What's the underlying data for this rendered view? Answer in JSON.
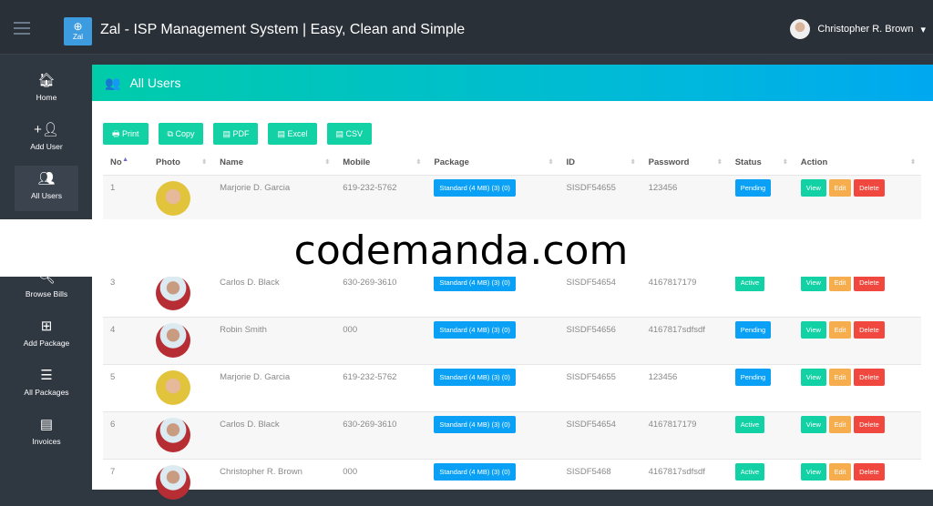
{
  "header": {
    "title": "Zal - ISP Management System | Easy, Clean and Simple",
    "logo_text": "Zal",
    "user": "Christopher R. Brown"
  },
  "sidebar": {
    "items": [
      {
        "label": "Home",
        "icon": "home-icon"
      },
      {
        "label": "Add User",
        "icon": "user-plus-icon"
      },
      {
        "label": "All Users",
        "icon": "users-icon"
      },
      {
        "label": "Browse Bills",
        "icon": "search-icon"
      },
      {
        "label": "Add Package",
        "icon": "plus-square-icon"
      },
      {
        "label": "All Packages",
        "icon": "list-icon"
      },
      {
        "label": "Invoices",
        "icon": "invoice-icon"
      }
    ]
  },
  "page": {
    "title": "All Users"
  },
  "export": {
    "print": "Print",
    "copy": "Copy",
    "pdf": "PDF",
    "excel": "Excel",
    "csv": "CSV"
  },
  "columns": [
    "No",
    "Photo",
    "Name",
    "Mobile",
    "Package",
    "ID",
    "Password",
    "Status",
    "Action"
  ],
  "actions": {
    "view": "View",
    "edit": "Edit",
    "delete": "Delete"
  },
  "rows": [
    {
      "no": "1",
      "photo": "female",
      "name": "Marjorie D. Garcia",
      "mobile": "619-232-5762",
      "package": "Standard (4 MB) (3) (0)",
      "id": "SISDF54655",
      "password": "123456",
      "status": "Pending"
    },
    {
      "no": "3",
      "photo": "male",
      "name": "Carlos D. Black",
      "mobile": "630-269-3610",
      "package": "Standard (4 MB) (3) (0)",
      "id": "SISDF54654",
      "password": "4167817179",
      "status": "Active"
    },
    {
      "no": "4",
      "photo": "male",
      "name": "Robin Smith",
      "mobile": "000",
      "package": "Standard (4 MB) (3) (0)",
      "id": "SISDF54656",
      "password": "4167817sdfsdf",
      "status": "Pending"
    },
    {
      "no": "5",
      "photo": "female",
      "name": "Marjorie D. Garcia",
      "mobile": "619-232-5762",
      "package": "Standard (4 MB) (3) (0)",
      "id": "SISDF54655",
      "password": "123456",
      "status": "Pending"
    },
    {
      "no": "6",
      "photo": "male",
      "name": "Carlos D. Black",
      "mobile": "630-269-3610",
      "package": "Standard (4 MB) (3) (0)",
      "id": "SISDF54654",
      "password": "4167817179",
      "status": "Active"
    },
    {
      "no": "7",
      "photo": "male",
      "name": "Christopher R. Brown",
      "mobile": "000",
      "package": "Standard (4 MB) (3) (0)",
      "id": "SISDF5468",
      "password": "4167817sdfsdf",
      "status": "Active"
    }
  ],
  "colors": {
    "pending": "#0aa0f5",
    "active": "#12d1a4",
    "view": "#12d1a4",
    "edit": "#f5ad4e",
    "delete": "#f0483e"
  },
  "watermark": "codemanda.com"
}
